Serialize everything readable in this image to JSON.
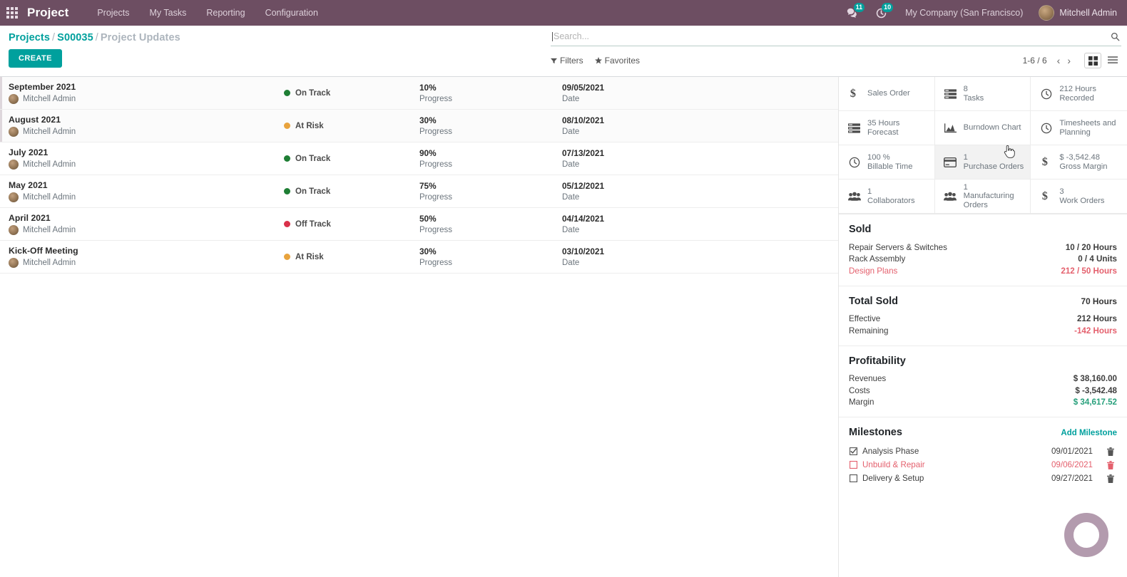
{
  "navbar": {
    "apps_icon": "apps-grid-icon",
    "brand": "Project",
    "menu": [
      {
        "label": "Projects"
      },
      {
        "label": "My Tasks"
      },
      {
        "label": "Reporting"
      },
      {
        "label": "Configuration"
      }
    ],
    "messages_badge": "11",
    "activities_badge": "10",
    "company": "My Company (San Francisco)",
    "user": "Mitchell Admin",
    "accent_color": "#6d4e62",
    "badge_color": "#00a09d"
  },
  "control_panel": {
    "breadcrumb": {
      "root": "Projects",
      "parent": "S00035",
      "current": "Project Updates",
      "separator": "/"
    },
    "create_label": "CREATE",
    "search": {
      "value": "",
      "placeholder": "Search..."
    },
    "filters_label": "Filters",
    "favorites_label": "Favorites",
    "pager": "1-6 / 6",
    "prev_arrow": "‹",
    "next_arrow": "›",
    "views": [
      {
        "name": "kanban",
        "active": true
      },
      {
        "name": "list",
        "active": false
      }
    ]
  },
  "updates": {
    "column_labels": {
      "progress": "Progress",
      "date": "Date"
    },
    "rows": [
      {
        "title": "September 2021",
        "author": "Mitchell Admin",
        "status": "On Track",
        "status_color": "#1e7e34",
        "progress": "10%",
        "date": "09/05/2021",
        "hovered": false
      },
      {
        "title": "August 2021",
        "author": "Mitchell Admin",
        "status": "At Risk",
        "status_color": "#e8a33d",
        "progress": "30%",
        "date": "08/10/2021",
        "hovered": true
      },
      {
        "title": "July 2021",
        "author": "Mitchell Admin",
        "status": "On Track",
        "status_color": "#1e7e34",
        "progress": "90%",
        "date": "07/13/2021",
        "hovered": false
      },
      {
        "title": "May 2021",
        "author": "Mitchell Admin",
        "status": "On Track",
        "status_color": "#1e7e34",
        "progress": "75%",
        "date": "05/12/2021",
        "hovered": false
      },
      {
        "title": "April 2021",
        "author": "Mitchell Admin",
        "status": "Off Track",
        "status_color": "#d9314a",
        "progress": "50%",
        "date": "04/14/2021",
        "hovered": false
      },
      {
        "title": "Kick-Off Meeting",
        "author": "Mitchell Admin",
        "status": "At Risk",
        "status_color": "#e8a33d",
        "progress": "30%",
        "date": "03/10/2021",
        "hovered": false
      }
    ]
  },
  "right_panel": {
    "stats": [
      {
        "icon": "dollar-icon",
        "value": "",
        "label": "Sales Order",
        "hovered": false
      },
      {
        "icon": "tasks-list-icon",
        "value": "8",
        "label": "Tasks",
        "hovered": false
      },
      {
        "icon": "clock-icon",
        "value": "212 Hours",
        "label": "Recorded",
        "hovered": false
      },
      {
        "icon": "tasks-list-icon",
        "value": "35 Hours",
        "label": "Forecast",
        "hovered": false
      },
      {
        "icon": "area-chart-icon",
        "value": "",
        "label": "Burndown Chart",
        "hovered": false
      },
      {
        "icon": "clock-icon",
        "value": "",
        "label": "Timesheets and Planning",
        "hovered": false
      },
      {
        "icon": "clock-icon",
        "value": "100 %",
        "label": "Billable Time",
        "hovered": false
      },
      {
        "icon": "credit-card-icon",
        "value": "1",
        "label": "Purchase Orders",
        "hovered": true
      },
      {
        "icon": "dollar-icon",
        "value": "$ -3,542.48",
        "label": "Gross Margin",
        "hovered": false
      },
      {
        "icon": "users-icon",
        "value": "1",
        "label": "Collaborators",
        "hovered": false
      },
      {
        "icon": "users-icon",
        "value": "1",
        "label": "Manufacturing Orders",
        "hovered": false
      },
      {
        "icon": "dollar-icon",
        "value": "3",
        "label": "Work Orders",
        "hovered": false
      }
    ],
    "sold": {
      "title": "Sold",
      "items": [
        {
          "name": "Repair Servers & Switches",
          "value": "10 / 20 Hours",
          "state": "normal"
        },
        {
          "name": "Rack Assembly",
          "value": "0 / 4 Units",
          "state": "normal"
        },
        {
          "name": "Design Plans",
          "value": "212 / 50 Hours",
          "state": "danger"
        }
      ]
    },
    "total_sold": {
      "title": "Total Sold",
      "total": "70 Hours",
      "items": [
        {
          "name": "Effective",
          "value": "212 Hours",
          "state": "normal"
        },
        {
          "name": "Remaining",
          "value": "-142 Hours",
          "state": "danger"
        }
      ]
    },
    "profitability": {
      "title": "Profitability",
      "items": [
        {
          "name": "Revenues",
          "value": "$ 38,160.00",
          "state": "normal"
        },
        {
          "name": "Costs",
          "value": "$ -3,542.48",
          "state": "normal"
        },
        {
          "name": "Margin",
          "value": "$ 34,617.52",
          "state": "success"
        }
      ]
    },
    "milestones": {
      "title": "Milestones",
      "add_label": "Add Milestone",
      "items": [
        {
          "name": "Analysis Phase",
          "date": "09/01/2021",
          "checked": true,
          "overdue": false
        },
        {
          "name": "Unbuild & Repair",
          "date": "09/06/2021",
          "checked": false,
          "overdue": true
        },
        {
          "name": "Delivery & Setup",
          "date": "09/27/2021",
          "checked": false,
          "overdue": false
        }
      ]
    },
    "spinner_color": "#a68aa0"
  }
}
